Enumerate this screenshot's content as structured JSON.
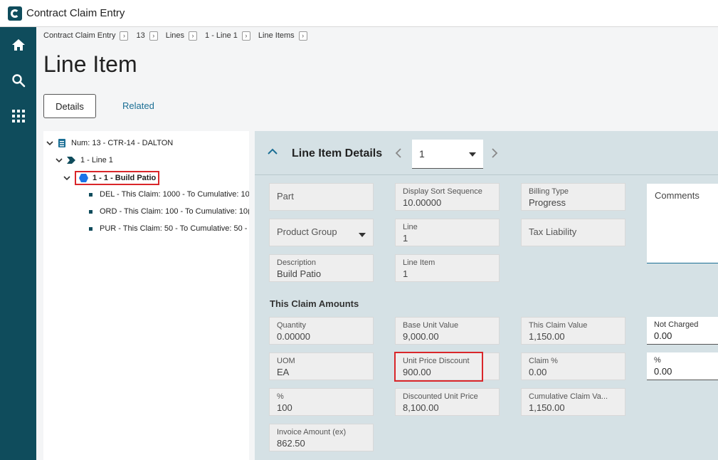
{
  "app": {
    "title": "Contract Claim Entry"
  },
  "rail": {
    "items": [
      {
        "icon": "home-icon"
      },
      {
        "icon": "search-icon"
      },
      {
        "icon": "grid-menu-icon"
      }
    ]
  },
  "breadcrumb": [
    "Contract Claim Entry",
    "13",
    "Lines",
    "1 - Line 1",
    "Line Items"
  ],
  "page": {
    "title": "Line Item"
  },
  "tabs": {
    "details": "Details",
    "related": "Related"
  },
  "tree": {
    "root": "Num: 13 - CTR-14 - DALTON",
    "line": "1 - Line 1",
    "item": "1 - 1 - Build Patio",
    "children": [
      "DEL - This Claim: 1000 - To Cumulative: 10",
      "ORD - This Claim: 100 - To Cumulative: 10(",
      "PUR - This Claim: 50 - To Cumulative: 50 -"
    ]
  },
  "detail": {
    "title": "Line Item Details",
    "selector_value": "1",
    "section_this_claim": "This Claim Amounts",
    "comments_label": "Comments",
    "fields": {
      "part": {
        "label": "Part"
      },
      "display_sort": {
        "label": "Display Sort Sequence",
        "value": "10.00000"
      },
      "billing_type": {
        "label": "Billing Type",
        "value": "Progress"
      },
      "product_group": {
        "label": "Product Group"
      },
      "line": {
        "label": "Line",
        "value": "1"
      },
      "tax_liability": {
        "label": "Tax Liability"
      },
      "description": {
        "label": "Description",
        "value": "Build Patio"
      },
      "line_item": {
        "label": "Line Item",
        "value": "1"
      },
      "quantity": {
        "label": "Quantity",
        "value": "0.00000"
      },
      "base_unit_value": {
        "label": "Base Unit Value",
        "value": "9,000.00"
      },
      "this_claim_value": {
        "label": "This Claim Value",
        "value": "1,150.00"
      },
      "not_charged": {
        "label": "Not Charged",
        "value": "0.00"
      },
      "uom": {
        "label": "UOM",
        "value": "EA"
      },
      "unit_price_discount": {
        "label": "Unit Price Discount",
        "value": "900.00"
      },
      "claim_pct": {
        "label": "Claim %",
        "value": "0.00"
      },
      "pct_editable": {
        "label": "%",
        "value": "0.00"
      },
      "pct": {
        "label": "%",
        "value": "100"
      },
      "discounted_unit_price": {
        "label": "Discounted Unit Price",
        "value": "8,100.00"
      },
      "cumulative_claim_value": {
        "label": "Cumulative Claim Va...",
        "value": "1,150.00"
      },
      "invoice_amount": {
        "label": "Invoice Amount (ex)",
        "value": "862.50"
      }
    }
  },
  "colors": {
    "rail": "#0f4c5c",
    "accent": "#1a6e94",
    "highlight": "#d9262a",
    "panel": "#d5e1e5"
  }
}
